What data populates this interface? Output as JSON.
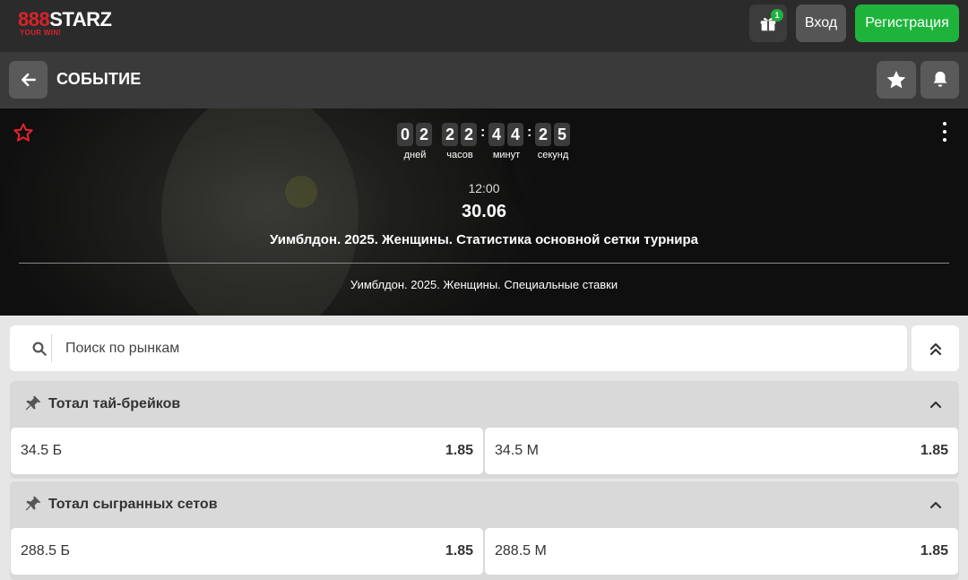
{
  "header": {
    "logo_prefix": "888",
    "logo_suffix": "STARZ",
    "logo_slogan": "YOUR WIN!",
    "gift_badge": "1",
    "login_label": "Вход",
    "register_label": "Регистрация"
  },
  "event_bar": {
    "title": "СОБЫТИЕ"
  },
  "hero": {
    "countdown": {
      "days": [
        "0",
        "2"
      ],
      "hours": [
        "2",
        "2"
      ],
      "minutes": [
        "4",
        "4"
      ],
      "seconds": [
        "2",
        "5"
      ],
      "separator": ":",
      "labels": {
        "days": "дней",
        "hours": "часов",
        "minutes": "минут",
        "seconds": "секунд"
      }
    },
    "time": "12:00",
    "date": "30.06",
    "tournament": "Уимблдон. 2025. Женщины. Статистика основной сетки турнира",
    "subtitle": "Уимблдон. 2025. Женщины. Специальные ставки"
  },
  "search": {
    "placeholder": "Поиск по рынкам",
    "value": ""
  },
  "markets": [
    {
      "title": "Тотал тай-брейков",
      "odds": [
        {
          "label": "34.5 Б",
          "value": "1.85"
        },
        {
          "label": "34.5 М",
          "value": "1.85"
        }
      ]
    },
    {
      "title": "Тотал сыгранных сетов",
      "odds": [
        {
          "label": "288.5 Б",
          "value": "1.85"
        },
        {
          "label": "288.5 М",
          "value": "1.85"
        }
      ]
    }
  ],
  "colors": {
    "accent_green": "#1eb43c",
    "brand_red": "#d8232a",
    "topbar_bg": "#2b2b2b",
    "eventbar_bg": "#3a3a3a"
  },
  "icons": [
    "gift-icon",
    "arrow-left-icon",
    "star-icon",
    "bell-icon",
    "star-outline-icon",
    "more-vertical-icon",
    "search-icon",
    "double-chevron-up-icon",
    "pin-icon",
    "chevron-up-icon"
  ]
}
